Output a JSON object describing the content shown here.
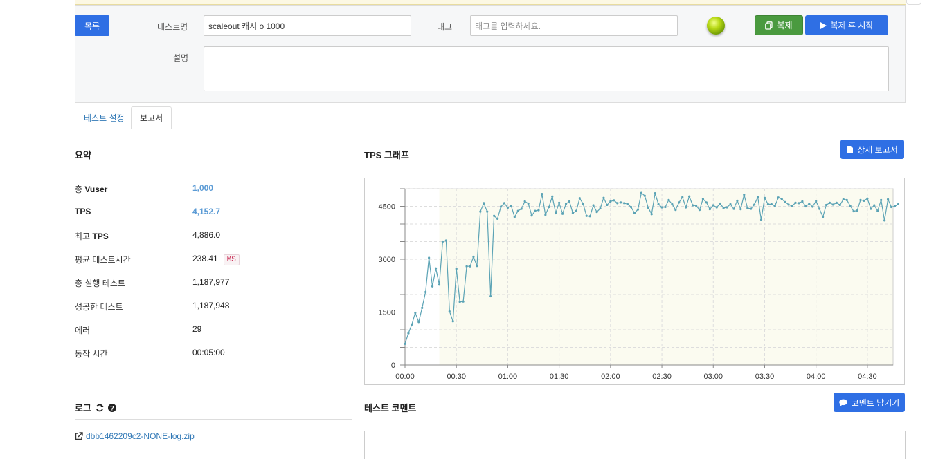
{
  "header": {
    "list_button": "목록",
    "test_name_label": "테스트명",
    "test_name_value": "scaleout 캐시 o 1000",
    "tag_label": "태그",
    "tag_placeholder": "태그를 입력하세요.",
    "description_label": "설명",
    "clone_button": "복제",
    "clone_start_button": "복제 후 시작",
    "status_color": "#b8d916"
  },
  "tabs": [
    {
      "label": "테스트 설정",
      "active": false
    },
    {
      "label": "보고서",
      "active": true
    }
  ],
  "summary": {
    "title": "요약",
    "rows": [
      {
        "label_pre": "총 ",
        "label_bold": "Vuser",
        "value": "1,000",
        "link": true
      },
      {
        "label_pre": "",
        "label_bold": "TPS",
        "value": "4,152.7",
        "link": true
      },
      {
        "label_pre": "최고 ",
        "label_bold": "TPS",
        "value": "4,886.0",
        "link": false
      },
      {
        "label_pre": "평균 테스트시간",
        "label_bold": "",
        "value": "238.41",
        "badge": "MS",
        "link": false
      },
      {
        "label_pre": "총 실행 테스트",
        "label_bold": "",
        "value": "1,187,977",
        "link": false
      },
      {
        "label_pre": "성공한 테스트",
        "label_bold": "",
        "value": "1,187,948",
        "link": false
      },
      {
        "label_pre": "에러",
        "label_bold": "",
        "value": "29",
        "link": false
      },
      {
        "label_pre": "동작 시간",
        "label_bold": "",
        "value": "00:05:00",
        "link": false
      }
    ]
  },
  "tps": {
    "title": "TPS 그래프",
    "detail_button": "상세 보고서"
  },
  "log": {
    "title": "로그",
    "file": "dbb1462209c2-NONE-log.zip"
  },
  "comment": {
    "title": "테스트 코멘트",
    "button": "코멘트 남기기"
  },
  "chart_data": {
    "type": "line",
    "title": "",
    "xlabel": "",
    "ylabel": "",
    "ylim": [
      0,
      5000
    ],
    "xlim_seconds": [
      0,
      285
    ],
    "x_ticks": [
      "00:00",
      "00:30",
      "01:00",
      "01:30",
      "02:00",
      "02:30",
      "03:00",
      "03:30",
      "04:00",
      "04:30"
    ],
    "y_ticks": [
      0,
      1500,
      3000,
      4500
    ],
    "grid": true,
    "line_color": "#5ba3b5",
    "series": [
      {
        "x_interval_seconds": 2,
        "values": [
          600,
          900,
          1150,
          1480,
          1220,
          1620,
          2070,
          3040,
          2230,
          2740,
          2280,
          3500,
          3530,
          1520,
          1240,
          2730,
          1790,
          1800,
          2800,
          2800,
          3070,
          2810,
          4350,
          4590,
          4350,
          1950,
          4230,
          4150,
          4490,
          4590,
          4460,
          4510,
          4200,
          4370,
          4430,
          4640,
          4580,
          4240,
          4370,
          4390,
          4850,
          4260,
          4480,
          4780,
          4310,
          4600,
          4290,
          4570,
          4640,
          4310,
          4370,
          4730,
          4570,
          4230,
          4220,
          4530,
          4340,
          4440,
          4740,
          4540,
          4640,
          4670,
          4590,
          4610,
          4590,
          4560,
          4480,
          4310,
          4410,
          4880,
          4800,
          4460,
          4280,
          4870,
          4560,
          4470,
          4480,
          4680,
          4560,
          4400,
          4610,
          4760,
          4470,
          4780,
          4530,
          4520,
          4400,
          4710,
          4610,
          4420,
          4530,
          4470,
          4580,
          4450,
          4470,
          4560,
          4430,
          4660,
          4420,
          4830,
          4450,
          4430,
          4550,
          4760,
          4120,
          4740,
          4560,
          4560,
          4510,
          4750,
          4710,
          4620,
          4550,
          4510,
          4600,
          4590,
          4640,
          4500,
          4570,
          4490,
          4650,
          4430,
          4200,
          4540,
          4600,
          4550,
          4600,
          4540,
          4700,
          4680,
          4510,
          4360,
          4380,
          4680,
          4660,
          4720,
          4430,
          4530,
          4370,
          4680,
          4100,
          4700,
          4480,
          4500,
          4560
        ]
      }
    ]
  }
}
